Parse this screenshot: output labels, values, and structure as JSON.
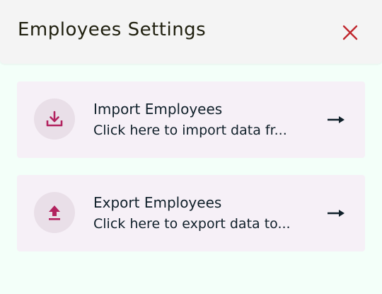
{
  "header": {
    "title": "Employees Settings",
    "close_icon": "close-icon"
  },
  "cards": [
    {
      "id": "import",
      "title": "Import Employees",
      "description": "Click here to import data fr...",
      "icon": "download-icon",
      "arrow_icon": "arrow-right-icon"
    },
    {
      "id": "export",
      "title": "Export Employees",
      "description": "Click here to export data to...",
      "icon": "upload-icon",
      "arrow_icon": "arrow-right-icon"
    }
  ],
  "colors": {
    "background": "#f3fff9",
    "header_bg": "#f4f4f4",
    "card_bg": "#f6f0f7",
    "icon_circle_bg": "#e9dfe8",
    "accent": "#b2225f",
    "close": "#c0272d",
    "text": "#10202a"
  }
}
